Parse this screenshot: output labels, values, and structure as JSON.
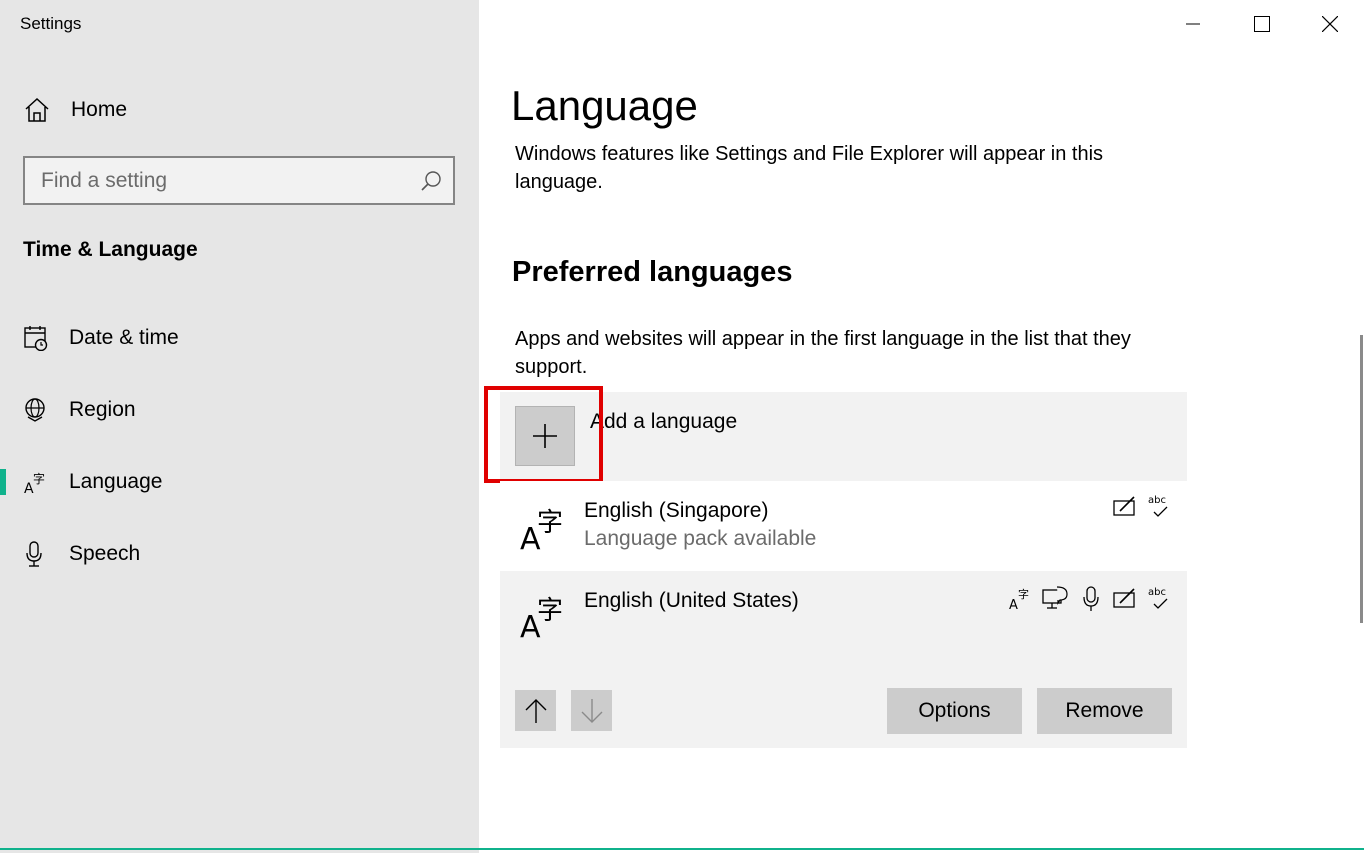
{
  "window": {
    "title": "Settings",
    "controls": [
      "minimize",
      "maximize",
      "close"
    ]
  },
  "sidebar": {
    "home_label": "Home",
    "search": {
      "placeholder": "Find a setting",
      "value": ""
    },
    "section_title": "Time & Language",
    "items": [
      {
        "label": "Date & time",
        "icon": "calendar-clock-icon",
        "active": false
      },
      {
        "label": "Region",
        "icon": "globe-icon",
        "active": false
      },
      {
        "label": "Language",
        "icon": "language-icon",
        "active": true
      },
      {
        "label": "Speech",
        "icon": "microphone-icon",
        "active": false
      }
    ],
    "accent_color": "#10b28c"
  },
  "main": {
    "title": "Language",
    "windows_display_desc": "Windows features like Settings and File Explorer will appear in this language.",
    "preferred_title": "Preferred languages",
    "preferred_desc": "Apps and websites will appear in the first language in the list that they support.",
    "add_language_label": "Add a language",
    "languages": [
      {
        "name": "English (Singapore)",
        "subtitle": "Language pack available",
        "features": [
          "handwriting-icon",
          "spellcheck-icon"
        ]
      },
      {
        "name": "English (United States)",
        "subtitle": "",
        "features": [
          "display-language-icon",
          "text-to-speech-icon",
          "speech-recognition-icon",
          "handwriting-icon",
          "spellcheck-icon"
        ]
      }
    ],
    "options_label": "Options",
    "remove_label": "Remove",
    "highlight_color": "#e00000"
  }
}
